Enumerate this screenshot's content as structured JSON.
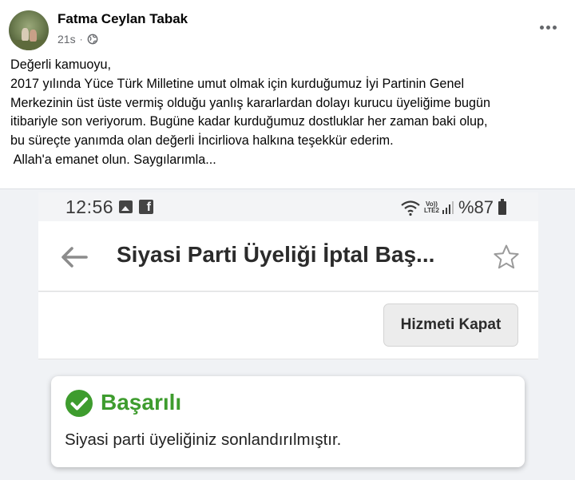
{
  "post": {
    "author": "Fatma Ceylan Tabak",
    "time": "21s",
    "separator": "·",
    "privacy_icon": "globe-icon",
    "more_icon": "more-options-icon",
    "text_lines": [
      "Değerli kamuoyu,",
      "2017 yılında Yüce Türk Milletine umut olmak için kurduğumuz İyi Partinin Genel",
      "Merkezinin üst üste vermiş olduğu yanlış kararlardan dolayı kurucu üyeliğime bugün",
      "itibariyle son veriyorum. Bugüne kadar kurduğumuz dostluklar her zaman baki olup,",
      "bu süreçte yanımda olan değerli İncirliova halkına teşekkür ederim.",
      " Allah'a emanet olun. Saygılarımla..."
    ]
  },
  "screenshot": {
    "status_bar": {
      "time": "12:56",
      "lte_top": "Vo))",
      "lte_bottom": "LTE2",
      "battery": "%87"
    },
    "app_bar": {
      "title": "Siyasi Parti Üyeliği İptal Baş..."
    },
    "actions": {
      "close_service": "Hizmeti Kapat"
    },
    "success": {
      "title": "Başarılı",
      "message": "Siyasi parti üyeliğiniz sonlandırılmıştır."
    },
    "colors": {
      "success_green": "#3e9c2e",
      "panel_bg": "#f0f2f5"
    }
  }
}
